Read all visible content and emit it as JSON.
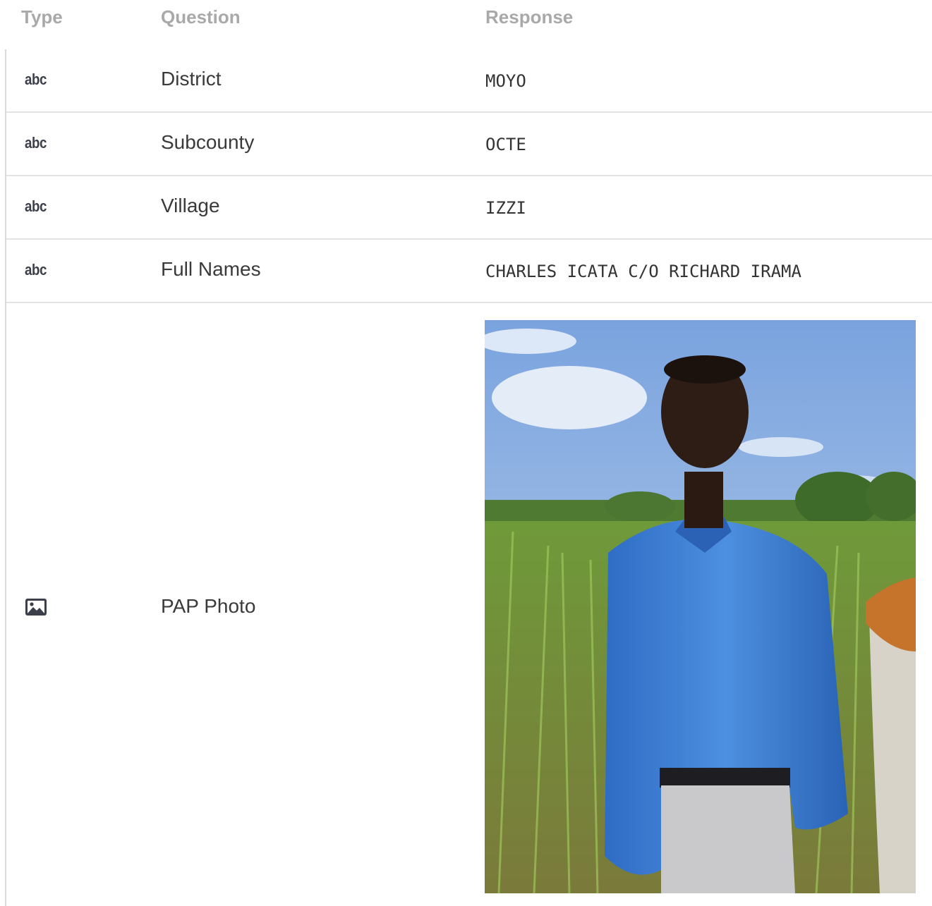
{
  "header": {
    "type": "Type",
    "question": "Question",
    "response": "Response"
  },
  "rows": [
    {
      "type_icon": "abc",
      "question": "District",
      "response": "MOYO"
    },
    {
      "type_icon": "abc",
      "question": "Subcounty",
      "response": "OCTE"
    },
    {
      "type_icon": "abc",
      "question": "Village",
      "response": "IZZI"
    },
    {
      "type_icon": "abc",
      "question": "Full Names",
      "response": "CHARLES ICATA C/O RICHARD IRAMA"
    },
    {
      "type_icon": "image-icon",
      "question": "PAP Photo",
      "response": "photo-of-person-in-field"
    }
  ],
  "colors": {
    "header_text": "#a9a9a9",
    "divider": "#e3e3e3",
    "icon": "#3b3f49"
  }
}
